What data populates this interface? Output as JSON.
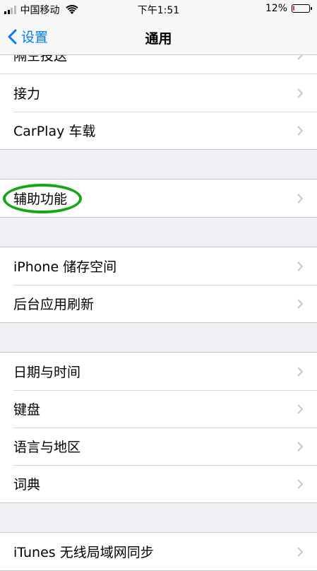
{
  "status_bar": {
    "carrier": "中国移动",
    "time": "下午1:51",
    "battery": "12%",
    "battery_level": 0.12,
    "battery_color": "#e5342e"
  },
  "nav": {
    "back_label": "设置",
    "title": "通用",
    "accent_color": "#007aff"
  },
  "groups": [
    {
      "items": [
        "隔空投送",
        "接力",
        "CarPlay 车载"
      ]
    },
    {
      "items": [
        "辅助功能"
      ]
    },
    {
      "items": [
        "iPhone 储存空间",
        "后台应用刷新"
      ]
    },
    {
      "items": [
        "日期与时间",
        "键盘",
        "语言与地区",
        "词典"
      ]
    },
    {
      "items": [
        "iTunes 无线局域网同步"
      ]
    }
  ],
  "annotation": {
    "highlighted_item": "辅助功能",
    "ring_color": "#19a517"
  }
}
